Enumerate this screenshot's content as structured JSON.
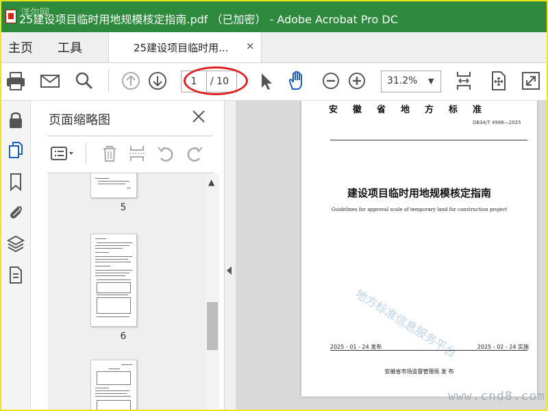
{
  "window": {
    "title": "25建设项目临时用地规模核定指南.pdf （已加密） - Adobe Acrobat Pro DC",
    "watermark": "洋尔网"
  },
  "menu": {
    "home": "主页",
    "tools": "工具"
  },
  "tab": {
    "label": "25建设项目临时用...",
    "close": "×"
  },
  "toolbar": {
    "page_current": "1",
    "page_total": "/ 10",
    "zoom": "31.2%"
  },
  "thumbnails": {
    "title": "页面缩略图",
    "pages": [
      "5",
      "6"
    ]
  },
  "document": {
    "header": "安徽省地方标准",
    "standard_no": "DB34/T 4986—2025",
    "title": "建设项目临时用地规模核定指南",
    "english_title": "Guidelines for approval scale of temporary land for construction project",
    "stamp": "地方标准信息服务平台",
    "publish_date": "2025 - 01 - 24 发布",
    "implement_date": "2025 - 02 - 24 实施",
    "issuer": "安徽省市场监督管理局    发 布"
  },
  "site_watermark": "www.cnd8.com",
  "colors": {
    "titlebar": "#2e8b3d",
    "accent": "#1a5fb4",
    "highlight_oval": "#e02020"
  }
}
